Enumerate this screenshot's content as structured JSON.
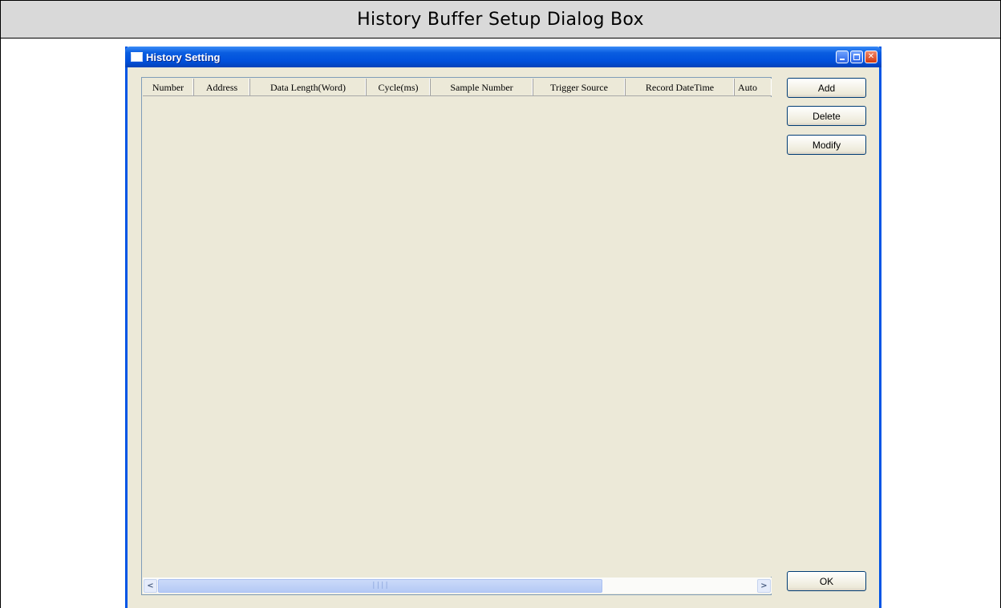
{
  "document": {
    "caption": "History Buffer Setup Dialog Box"
  },
  "window": {
    "title": "History Setting",
    "controls": {
      "minimize_icon": "minimize-icon",
      "maximize_icon": "maximize-icon",
      "close_icon": "close-icon"
    },
    "colors": {
      "titlebar": "#0050dc",
      "frame": "#0055e5",
      "face": "#ece9d8"
    }
  },
  "list": {
    "columns": [
      "Number",
      "Address",
      "Data Length(Word)",
      "Cycle(ms)",
      "Sample Number",
      "Trigger Source",
      "Record DateTime",
      "Auto"
    ],
    "rows": [],
    "scrollbar": {
      "left_arrow": "<",
      "right_arrow": ">",
      "thumb_grip": "||||"
    }
  },
  "buttons": {
    "add": "Add",
    "delete": "Delete",
    "modify": "Modify",
    "ok": "OK"
  }
}
